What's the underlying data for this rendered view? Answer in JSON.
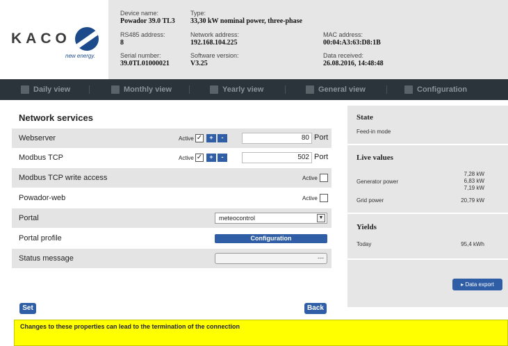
{
  "logo": {
    "text": "KACO",
    "tagline": "new energy."
  },
  "device": {
    "device_name_label": "Device name:",
    "device_name": "Powador 39.0 TL3",
    "type_label": "Type:",
    "type": "33,30 kW nominal power, three-phase",
    "rs485_label": "RS485 address:",
    "rs485": "8",
    "network_label": "Network address:",
    "network": "192.168.104.225",
    "mac_label": "MAC address:",
    "mac": "00:04:A3:63:D8:1B",
    "serial_label": "Serial number:",
    "serial": "39.0TL01000021",
    "software_label": "Software version:",
    "software": "V3.25",
    "data_received_label": "Data received:",
    "data_received": "26.08.2016, 14:48:48"
  },
  "nav": {
    "daily": "Daily view",
    "monthly": "Monthly view",
    "yearly": "Yearly view",
    "general": "General view",
    "configuration": "Configuration"
  },
  "network_services": {
    "title": "Network services",
    "active_label": "Active",
    "port_label": "Port",
    "plus": "+",
    "minus": "-",
    "webserver": {
      "label": "Webserver",
      "port": "80",
      "checked": "✓"
    },
    "modbus": {
      "label": "Modbus TCP",
      "port": "502",
      "checked": "✓"
    },
    "modbus_write": {
      "label": "Modbus TCP write access"
    },
    "powador_web": {
      "label": "Powador-web"
    },
    "portal": {
      "label": "Portal",
      "value": "meteocontrol"
    },
    "portal_profile": {
      "label": "Portal profile",
      "button": "Configuration"
    },
    "status_message": {
      "label": "Status message",
      "value": "---"
    },
    "set_button": "Set",
    "back_button": "Back",
    "warning": "Changes to these properties can lead to the termination of the connection"
  },
  "sidebar": {
    "state_title": "State",
    "state_value": "Feed-in mode",
    "live_title": "Live values",
    "generator_label": "Generator power",
    "generator_values": [
      "7,28 kW",
      "6,83 kW",
      "7,19 kW"
    ],
    "grid_label": "Grid power",
    "grid_value": "20,79 kW",
    "yields_title": "Yields",
    "today_label": "Today",
    "today_value": "95,4 kWh",
    "export_button": "Data export"
  }
}
